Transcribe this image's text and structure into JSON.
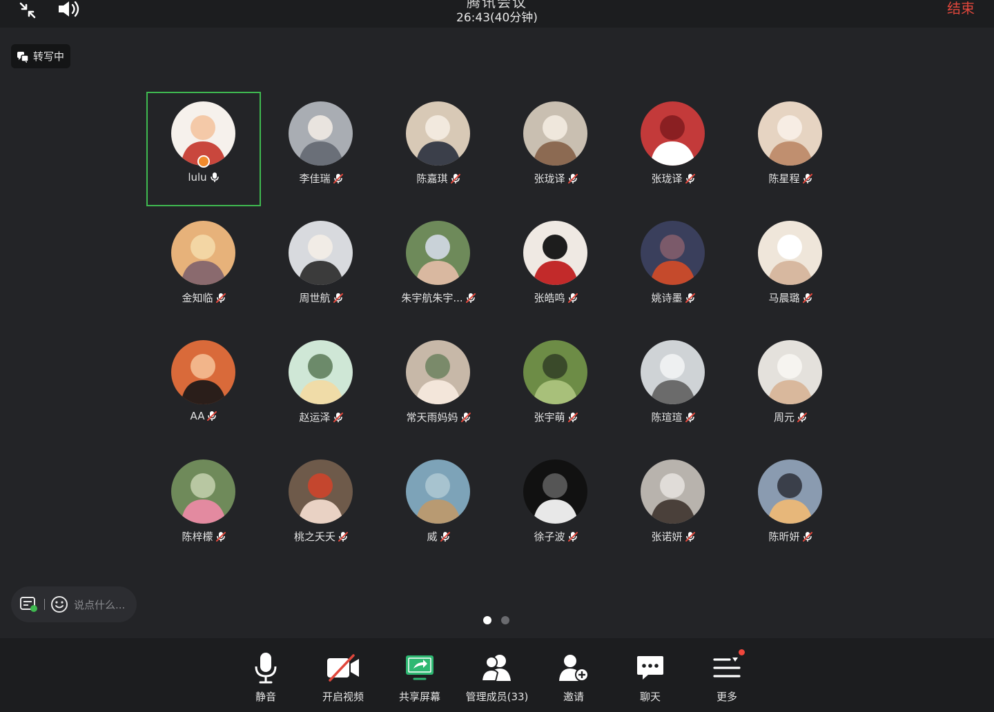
{
  "topbar": {
    "title": "腾讯会议",
    "elapsed": "26:43(40分钟)",
    "end_label": "结束"
  },
  "transcribe": {
    "label": "转写中"
  },
  "participants": [
    {
      "name": "lulu",
      "mic": "on",
      "active": true
    },
    {
      "name": "李佳瑞",
      "mic": "muted"
    },
    {
      "name": "陈嘉琪",
      "mic": "muted"
    },
    {
      "name": "张珑译",
      "mic": "muted"
    },
    {
      "name": "张珑译",
      "mic": "muted"
    },
    {
      "name": "陈星程",
      "mic": "muted"
    },
    {
      "name": "金知临",
      "mic": "muted"
    },
    {
      "name": "周世航",
      "mic": "muted"
    },
    {
      "name": "朱宇航朱宇...",
      "mic": "muted"
    },
    {
      "name": "张皓鸣",
      "mic": "muted"
    },
    {
      "name": "姚诗墨",
      "mic": "muted"
    },
    {
      "name": "马晨璐",
      "mic": "muted"
    },
    {
      "name": "AA",
      "mic": "muted"
    },
    {
      "name": "赵运泽",
      "mic": "muted"
    },
    {
      "name": "常天雨妈妈",
      "mic": "muted"
    },
    {
      "name": "张宇萌",
      "mic": "muted"
    },
    {
      "name": "陈瑄瑄",
      "mic": "muted"
    },
    {
      "name": "周元",
      "mic": "muted"
    },
    {
      "name": "陈梓檬",
      "mic": "muted"
    },
    {
      "name": "桃之夭夭",
      "mic": "muted"
    },
    {
      "name": "威",
      "mic": "muted"
    },
    {
      "name": "徐子波",
      "mic": "muted"
    },
    {
      "name": "张诺妍",
      "mic": "muted"
    },
    {
      "name": "陈昕妍",
      "mic": "muted"
    }
  ],
  "chat": {
    "placeholder": "说点什么..."
  },
  "pager": {
    "current": 1,
    "total": 2
  },
  "toolbar": {
    "mute": "静音",
    "video": "开启视频",
    "share": "共享屏幕",
    "members": "管理成员(33)",
    "invite": "邀请",
    "chat": "聊天",
    "more": "更多"
  },
  "colors": {
    "background": "#232427",
    "bar": "#1c1d1f",
    "end": "#e0473c",
    "active_border": "#3fb950",
    "share_green": "#2eb872",
    "video_red": "#e0473c"
  }
}
